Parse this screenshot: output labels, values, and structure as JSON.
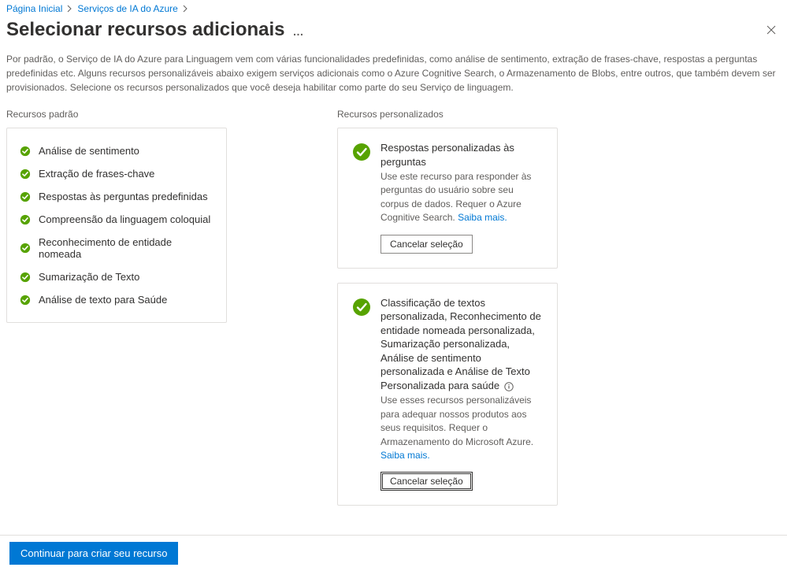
{
  "breadcrumb": {
    "home": "Página Inicial",
    "services": "Serviços de IA do Azure"
  },
  "title": "Selecionar recursos adicionais",
  "intro": "Por padrão, o Serviço de IA do Azure para Linguagem vem com várias funcionalidades predefinidas, como análise de sentimento, extração de frases-chave, respostas a perguntas predefinidas etc. Alguns recursos personalizáveis abaixo exigem serviços adicionais como o Azure Cognitive Search, o Armazenamento de Blobs, entre outros, que também devem ser provisionados. Selecione os recursos personalizados que você deseja habilitar como parte do seu Serviço de linguagem.",
  "sections": {
    "standard_heading": "Recursos padrão",
    "custom_heading": "Recursos personalizados"
  },
  "standard_items": [
    "Análise de sentimento",
    "Extração de frases-chave",
    "Respostas às perguntas predefinidas",
    "Compreensão da linguagem coloquial",
    "Reconhecimento de entidade nomeada",
    "Sumarização de Texto",
    "Análise de texto para Saúde"
  ],
  "custom": [
    {
      "title": "Respostas personalizadas às perguntas",
      "desc": "Use este recurso para responder às perguntas do usuário sobre seu corpus de dados. Requer o Azure Cognitive Search.",
      "learn": "Saiba mais.",
      "button": "Cancelar seleção"
    },
    {
      "title": "Classificação de textos personalizada, Reconhecimento de entidade nomeada personalizada, Sumarização personalizada, Análise de sentimento personalizada e Análise de Texto Personalizada para saúde",
      "desc": "Use esses recursos personalizáveis para adequar nossos produtos aos seus requisitos. Requer o Armazenamento do Microsoft Azure.",
      "learn": "Saiba mais.",
      "button": "Cancelar seleção"
    }
  ],
  "footer": {
    "primary": "Continuar para criar seu recurso"
  }
}
